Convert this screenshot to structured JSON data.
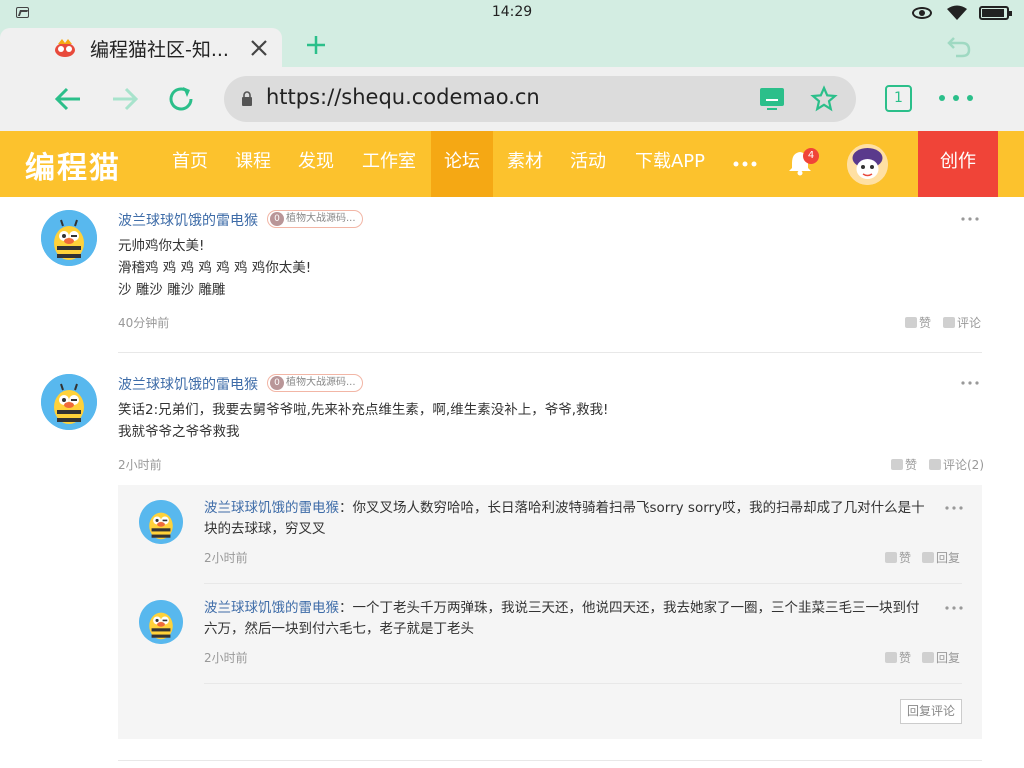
{
  "status_bar": {
    "time": "14:29"
  },
  "browser": {
    "tab_title": "编程猫社区-知...",
    "url": "https://shequ.codemao.cn",
    "tab_count": "1"
  },
  "site": {
    "logo": "编程猫",
    "nav": [
      {
        "label": "首页",
        "active": false
      },
      {
        "label": "课程",
        "active": false
      },
      {
        "label": "发现",
        "active": false
      },
      {
        "label": "工作室",
        "active": false
      },
      {
        "label": "论坛",
        "active": true
      },
      {
        "label": "素材",
        "active": false
      },
      {
        "label": "活动",
        "active": false
      },
      {
        "label": "下载APP",
        "active": false
      }
    ],
    "notification_count": "4",
    "create_label": "创作"
  },
  "comments": [
    {
      "user": "波兰球球饥饿的雷电猴",
      "level": "0",
      "badge": "植物大战源码...",
      "lines": [
        "元帅鸡你太美!",
        "滑稽鸡 鸡 鸡 鸡 鸡 鸡 鸡你太美!",
        "沙 雕沙 雕沙 雕雕"
      ],
      "time": "40分钟前",
      "like_label": "赞",
      "comment_label": "评论"
    },
    {
      "user": "波兰球球饥饿的雷电猴",
      "level": "0",
      "badge": "植物大战源码...",
      "lines": [
        "笑话2:兄弟们，我要去舅爷爷啦,先来补充点维生素，啊,维生素没补上，爷爷,救我!",
        "我就爷爷之爷爷救我"
      ],
      "time": "2小时前",
      "like_label": "赞",
      "comment_label": "评论(2)",
      "replies": [
        {
          "user": "波兰球球饥饿的雷电猴",
          "text": "：你叉叉场人数穷哈哈，长日落哈利波特骑着扫帚飞sorry sorry哎，我的扫帚却成了几对什么是十块的去球球，穷叉叉",
          "time": "2小时前",
          "like_label": "赞",
          "reply_label": "回复"
        },
        {
          "user": "波兰球球饥饿的雷电猴",
          "text": "：一个丁老头千万两弹珠，我说三天还，他说四天还，我去她家了一圈，三个韭菜三毛三一块到付六万，然后一块到付六毛七，老子就是丁老头",
          "time": "2小时前",
          "like_label": "赞",
          "reply_label": "回复"
        }
      ],
      "reply_comment_label": "回复评论"
    }
  ],
  "colors": {
    "brand_yellow": "#fcc22d",
    "nav_active": "#f5a814",
    "create_red": "#f04438",
    "browser_green": "#2bbf8a",
    "username_blue": "#3e6ca8"
  }
}
